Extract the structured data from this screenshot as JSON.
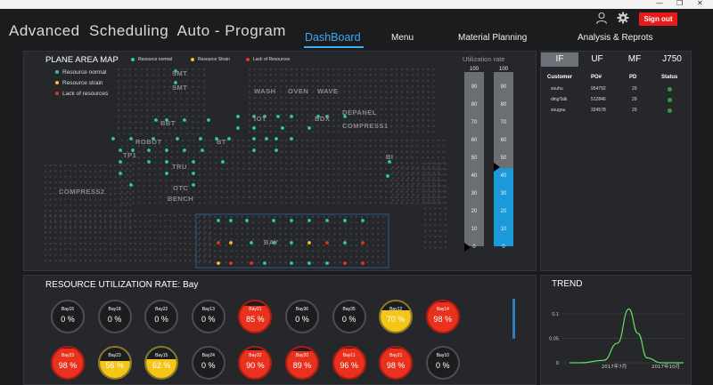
{
  "window": {
    "min_icon": "—",
    "restore_icon": "❐",
    "close_icon": "✕"
  },
  "app": {
    "title": "Advanced  Scheduling  Auto - Program"
  },
  "nav": [
    {
      "label": "DashBoard",
      "active": true
    },
    {
      "label": "Menu"
    },
    {
      "label": "Material Planning"
    },
    {
      "label": "Analysis & Reprots"
    }
  ],
  "header": {
    "user_icon": "user-icon",
    "settings_icon": "gear-icon",
    "signout_label": "Sign out"
  },
  "colors": {
    "accent": "#3fa9f5",
    "normal": "#2ecc9a",
    "strain": "#f5c518",
    "lack": "#e8321e",
    "bar_fill": "#1a9ad8",
    "signout": "#e81a1a"
  },
  "map": {
    "title": "PLANE AREA MAP",
    "legend": {
      "normal": "Resource normal",
      "strain": "Resource Strain",
      "lack": "Lack of Resources"
    },
    "legend_left": [
      "Resource normal",
      "Resource strain",
      "Lack of resources"
    ],
    "zones": [
      "SMT",
      "SMT",
      "WASH",
      "OVEN",
      "WAVE",
      "DEPANEL",
      "COMPRESS1",
      "BBT",
      "IOT",
      "BDX",
      "ROBOT",
      "TP1",
      "TRU",
      "BT",
      "BI",
      "OTC",
      "BENCH",
      "COMPRESS2",
      "BAY"
    ]
  },
  "utilization": {
    "title": "Utilization rate",
    "ticks": [
      "100",
      "90",
      "80",
      "70",
      "60",
      "50",
      "40",
      "30",
      "20",
      "10",
      "0"
    ],
    "bars": [
      {
        "name": "bar-1",
        "value": 0
      },
      {
        "name": "bar-2",
        "value": 45
      }
    ]
  },
  "side": {
    "tabs": [
      "IF",
      "UF",
      "MF",
      "J750"
    ],
    "active_tab": "IF",
    "headers": [
      "Customer",
      "PO#",
      "PD",
      "Status"
    ],
    "rows": [
      {
        "customer": "souhu",
        "po": "954792",
        "pd": "29",
        "status": "ok"
      },
      {
        "customer": "dingTalk",
        "po": "512846",
        "pd": "29",
        "status": "ok"
      },
      {
        "customer": "sougou",
        "po": "324578",
        "pd": "29",
        "status": "ok"
      }
    ]
  },
  "resource": {
    "title": "RESOURCE UTILIZATION RATE:  Bay",
    "gauges": [
      {
        "name": "Bay16",
        "value": "0 %",
        "fill": 0,
        "color": "none"
      },
      {
        "name": "Bay18",
        "value": "0 %",
        "fill": 0,
        "color": "none"
      },
      {
        "name": "Bay22",
        "value": "0 %",
        "fill": 0,
        "color": "none"
      },
      {
        "name": "Bay13",
        "value": "0 %",
        "fill": 0,
        "color": "none"
      },
      {
        "name": "Bay31",
        "value": "85 %",
        "fill": 85,
        "color": "red"
      },
      {
        "name": "Bay36",
        "value": "0 %",
        "fill": 0,
        "color": "none"
      },
      {
        "name": "Bay35",
        "value": "0 %",
        "fill": 0,
        "color": "none"
      },
      {
        "name": "Bay12",
        "value": "70 %",
        "fill": 70,
        "color": "yellow"
      },
      {
        "name": "Bay14",
        "value": "98 %",
        "fill": 98,
        "color": "red"
      },
      {
        "name": "Bay33",
        "value": "98 %",
        "fill": 98,
        "color": "red"
      },
      {
        "name": "Bay23",
        "value": "56 %",
        "fill": 56,
        "color": "yellow"
      },
      {
        "name": "Bay15",
        "value": "62 %",
        "fill": 62,
        "color": "yellow"
      },
      {
        "name": "Bay24",
        "value": "0 %",
        "fill": 0,
        "color": "none"
      },
      {
        "name": "Bay32",
        "value": "90 %",
        "fill": 90,
        "color": "red"
      },
      {
        "name": "Bay20",
        "value": "89 %",
        "fill": 89,
        "color": "red"
      },
      {
        "name": "Bay11",
        "value": "96 %",
        "fill": 96,
        "color": "red"
      },
      {
        "name": "Bay21",
        "value": "98 %",
        "fill": 98,
        "color": "red"
      },
      {
        "name": "Bay10",
        "value": "0 %",
        "fill": 0,
        "color": "none"
      }
    ]
  },
  "trend": {
    "title": "TREND",
    "chart_data": {
      "type": "line",
      "x_ticks": [
        "2017年7月",
        "2017年10月"
      ],
      "y_ticks": [
        "0.1",
        "0.05",
        "0"
      ],
      "ylim": [
        0,
        0.12
      ],
      "series": [
        {
          "color": "#5fe060",
          "points": [
            [
              0,
              0
            ],
            [
              0.1,
              0
            ],
            [
              0.3,
              0.005
            ],
            [
              0.42,
              0.04
            ],
            [
              0.52,
              0.11
            ],
            [
              0.6,
              0.06
            ],
            [
              0.68,
              0.01
            ],
            [
              0.8,
              0
            ],
            [
              1,
              0
            ]
          ]
        }
      ]
    }
  }
}
